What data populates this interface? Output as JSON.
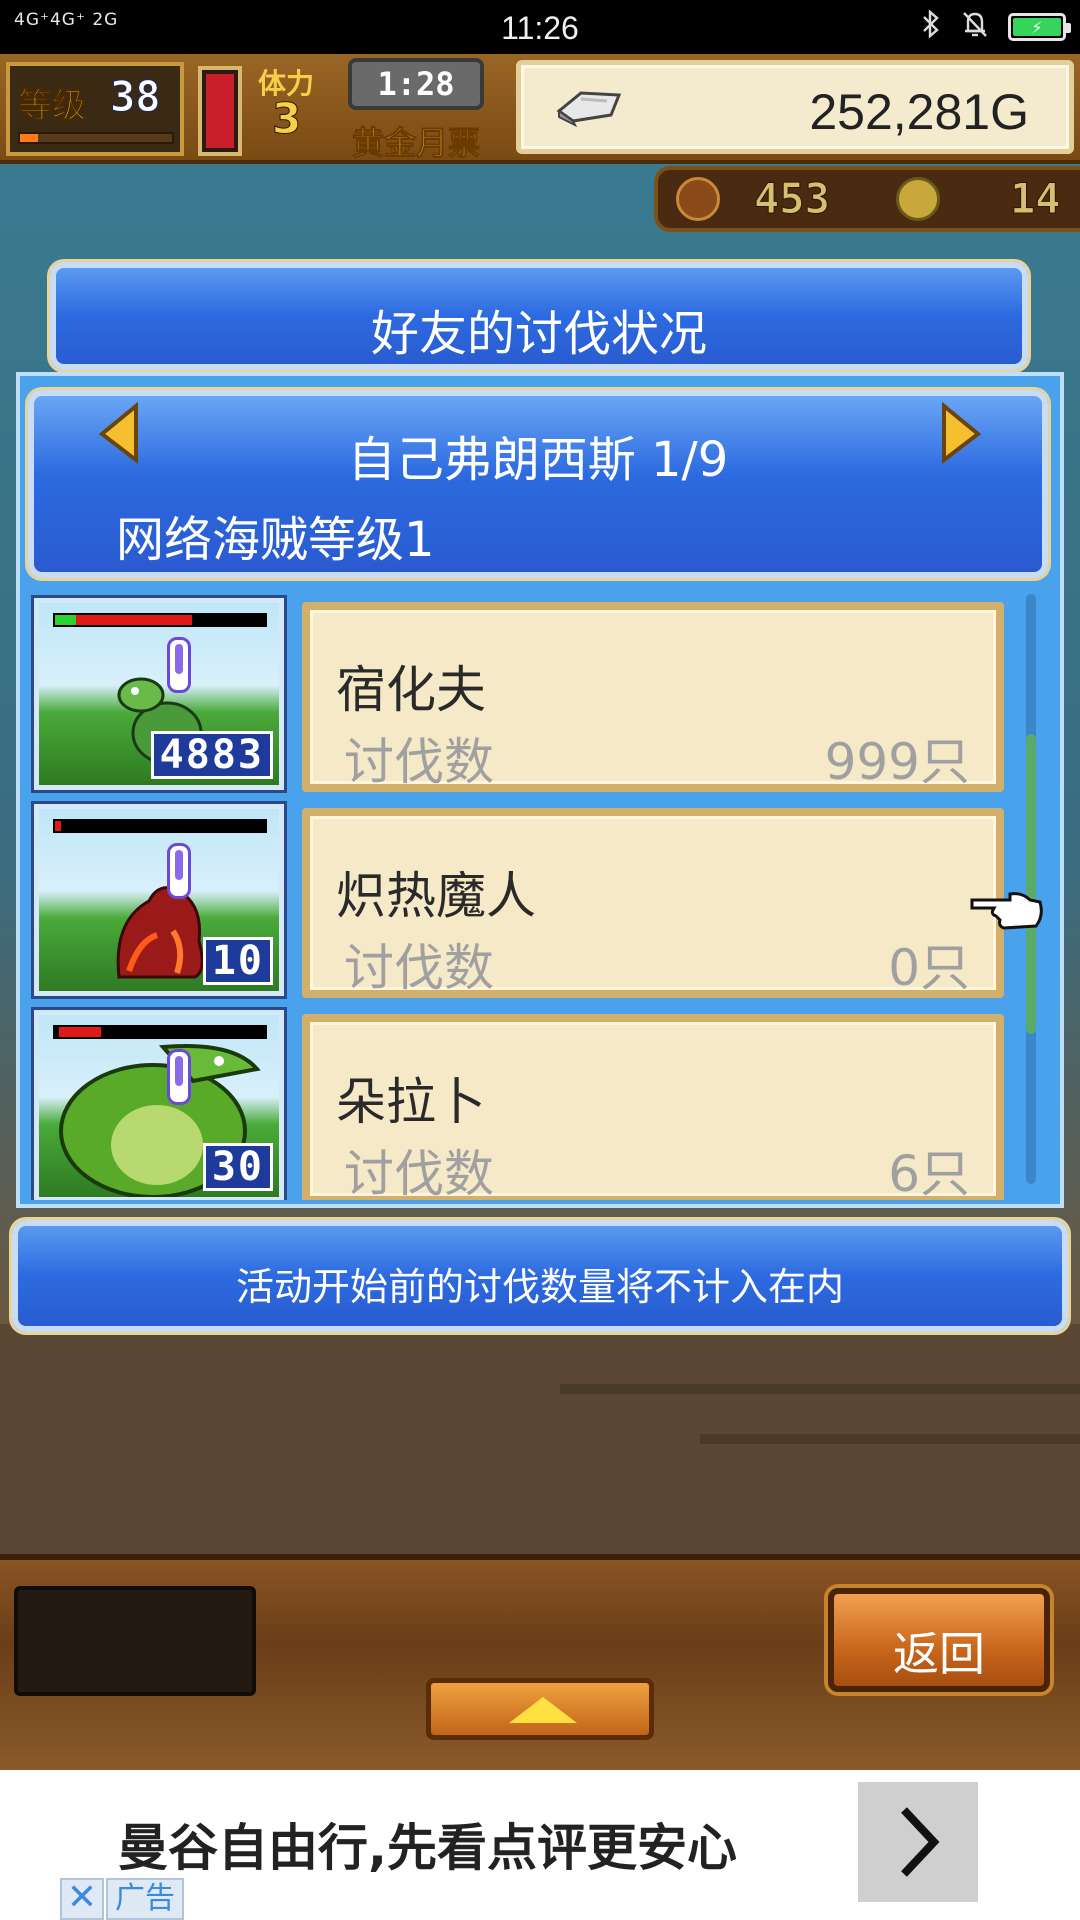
{
  "status_bar": {
    "signal_text": "4G⁺4G⁺ 2G",
    "time": "11:26",
    "battery_percent": 100
  },
  "hud": {
    "level_label": "等级",
    "level_value": "38",
    "stamina_label": "体力",
    "stamina_value": "3",
    "timer": "1:28",
    "gold_ticket_label": "黄金月票",
    "money": "252,281G",
    "resource_1": "453",
    "resource_2": "14"
  },
  "dialog": {
    "title": "好友的讨伐状况",
    "friend_name": "自己弗朗西斯 1/9",
    "friend_rank": "网络海贼等级1",
    "notice": "活动开始前的讨伐数量将不计入在内"
  },
  "monsters": [
    {
      "name": "宿化夫",
      "count_label": "讨伐数",
      "count": "999只",
      "badge": "4883",
      "hp_green": 0.1,
      "hp_red": 0.55
    },
    {
      "name": "炽热魔人",
      "count_label": "讨伐数",
      "count": "0只",
      "badge": "10",
      "hp_green": 0,
      "hp_red": 0.03
    },
    {
      "name": "朵拉卜",
      "count_label": "讨伐数",
      "count": "6只",
      "badge": "30",
      "hp_green": 0,
      "hp_red": 0.2
    }
  ],
  "buttons": {
    "back": "返回"
  },
  "ad": {
    "text": "曼谷自由行,先看点评更安心",
    "close": "✕",
    "tag": "广告"
  },
  "colors": {
    "dialog_blue": "#2c6ae0",
    "card_cream": "#f6e9c8",
    "back_button_orange": "#e08a36",
    "money_panel": "#f4ebcf"
  },
  "icons": [
    "bluetooth-icon",
    "mute-bell-icon",
    "battery-icon",
    "silver-ingot-icon",
    "meat-icon",
    "coin-icon",
    "arrow-left-icon",
    "arrow-right-icon",
    "hand-pointer-icon",
    "up-arrow-icon",
    "chevron-right-icon",
    "close-icon"
  ]
}
